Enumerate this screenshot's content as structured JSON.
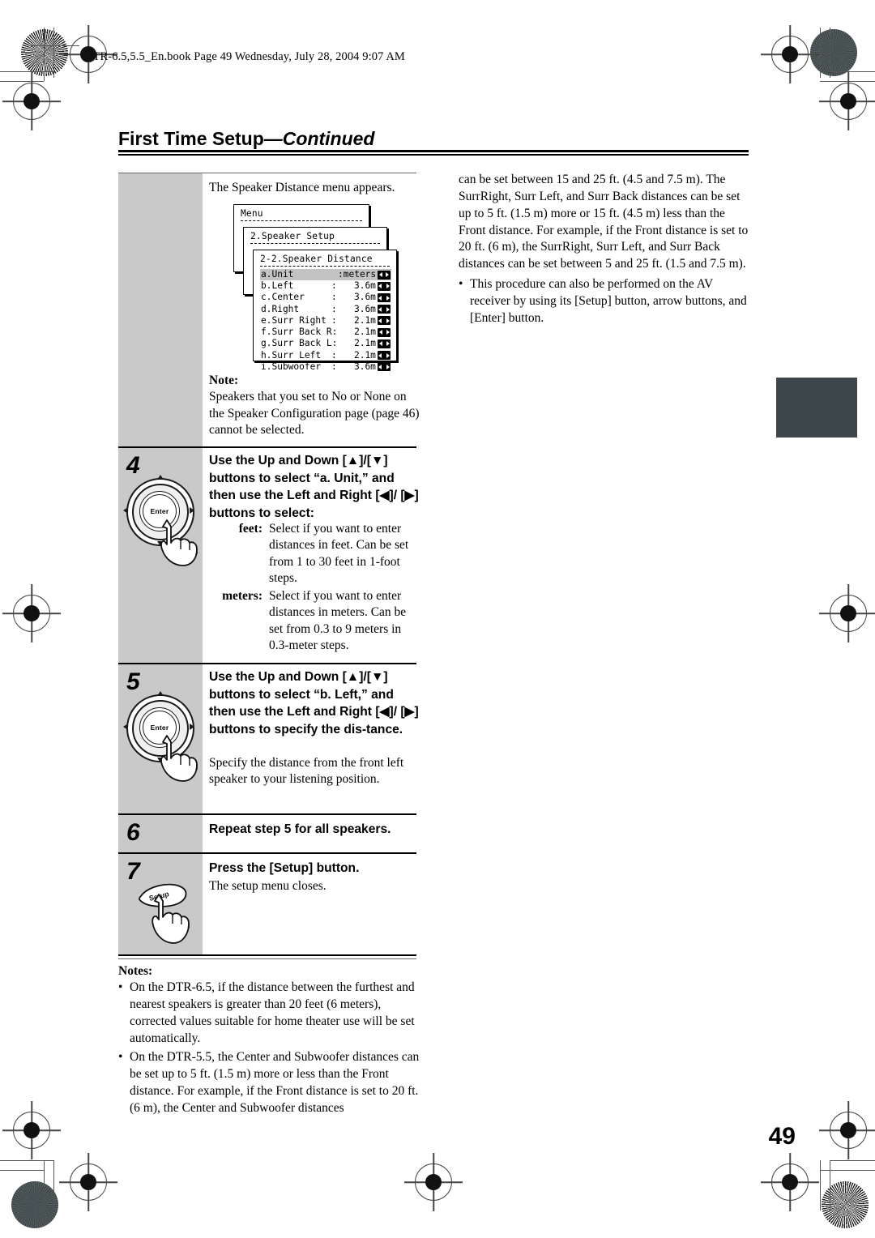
{
  "document": {
    "file_header": "DTR-6.5,5.5_En.book  Page 49  Wednesday, July 28, 2004  9:07 AM",
    "title_main": "First Time Setup",
    "title_continued": "—Continued",
    "page_number": "49"
  },
  "left_column": {
    "intro": "The Speaker Distance menu appears.",
    "osd": {
      "window1_title": "Menu",
      "window2_title": "2.Speaker Setup",
      "window3_title": "2-2.Speaker Distance",
      "rows": [
        {
          "label": "a.Unit",
          "colon": "",
          "value": ":meters",
          "selected": true
        },
        {
          "label": "b.Left",
          "colon": ":",
          "value": "3.6m",
          "selected": false
        },
        {
          "label": "c.Center",
          "colon": ":",
          "value": "3.6m",
          "selected": false
        },
        {
          "label": "d.Right",
          "colon": ":",
          "value": "3.6m",
          "selected": false
        },
        {
          "label": "e.Surr Right",
          "colon": ":",
          "value": "2.1m",
          "selected": false
        },
        {
          "label": "f.Surr Back R",
          "colon": ":",
          "value": "2.1m",
          "selected": false
        },
        {
          "label": "g.Surr Back L",
          "colon": ":",
          "value": "2.1m",
          "selected": false
        },
        {
          "label": "h.Surr Left",
          "colon": ":",
          "value": "2.1m",
          "selected": false
        },
        {
          "label": "i.Subwoofer",
          "colon": ":",
          "value": "3.6m",
          "selected": false
        }
      ]
    },
    "note": {
      "heading": "Note:",
      "body": "Speakers that you set to No or None on the Speaker Configuration page (page 46) cannot be selected."
    },
    "steps": [
      {
        "number": "4",
        "heading": "Use the Up and Down [▲]/[▼] buttons to select “a. Unit,” and then use the Left and Right [◀]/ [▶] buttons to select:",
        "definitions": [
          {
            "term": "feet:",
            "desc": "Select if you want to enter distances in feet. Can be set from 1 to 30 feet in 1-foot steps."
          },
          {
            "term": "meters:",
            "desc": "Select if you want to enter distances in meters. Can be set from 0.3 to 9 meters in 0.3-meter steps."
          }
        ],
        "icon": "remote-navpad-enter"
      },
      {
        "number": "5",
        "heading": "Use the Up and Down [▲]/[▼] buttons to select “b. Left,” and then use the Left and Right [◀]/ [▶] buttons to specify the dis-tance.",
        "body": "Specify the distance from the front left speaker to your listening position.",
        "icon": "remote-navpad-enter"
      },
      {
        "number": "6",
        "heading": "Repeat step 5 for all speakers.",
        "body": "",
        "icon": ""
      },
      {
        "number": "7",
        "heading": "Press the [Setup] button.",
        "body": "The setup menu closes.",
        "icon": "setup-button",
        "icon_label": "Setup"
      }
    ]
  },
  "right_column": {
    "continued_paragraph": "can be set between 15 and 25 ft. (4.5 and 7.5 m). The SurrRight, Surr Left, and Surr Back distances can be set up to 5 ft. (1.5 m) more or 15 ft. (4.5 m) less than the Front distance. For example, if the Front distance is set to 20 ft. (6 m), the SurrRight, Surr Left, and Surr Back distances can be set between 5 and 25 ft. (1.5 and 7.5 m).",
    "bullet": "This procedure can also be performed on the AV receiver by using its [Setup] button, arrow buttons, and [Enter] button."
  },
  "notes_section": {
    "heading": "Notes:",
    "items": [
      "On the DTR-6.5, if the distance between the furthest and nearest speakers is greater than 20 feet (6 meters), corrected values suitable for home theater use will be set automatically.",
      "On the DTR-5.5, the Center and Subwoofer distances can be set up to 5 ft. (1.5 m) more or less than the Front distance. For example, if the Front distance is set to 20 ft. (6 m), the Center and Subwoofer distances"
    ]
  },
  "colors": {
    "step_band": "#c9c9c9",
    "tab_marker": "#3d464a",
    "osd_highlight": "#c3c3c3"
  }
}
